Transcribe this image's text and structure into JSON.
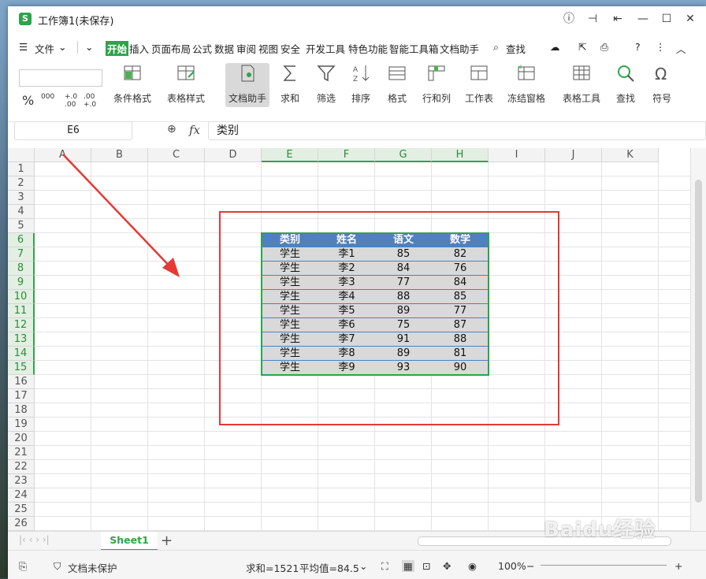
{
  "window": {
    "title": "工作簿1(未保存)",
    "app_icon": "S"
  },
  "menu": {
    "file": "文件",
    "tabs": [
      "开始",
      "插入",
      "页面布局",
      "公式",
      "数据",
      "审阅",
      "视图",
      "安全",
      "开发工具",
      "特色功能",
      "智能工具箱",
      "文档助手"
    ],
    "search": "查找"
  },
  "ribbon": {
    "buttons": [
      "条件格式",
      "表格样式",
      "文档助手",
      "求和",
      "筛选",
      "排序",
      "格式",
      "行和列",
      "工作表",
      "冻结窗格",
      "表格工具",
      "查找",
      "符号"
    ],
    "number_formats": [
      "%",
      "000",
      "+.0 .00",
      ".00 +.0"
    ]
  },
  "formula_bar": {
    "name_box": "E6",
    "fx": "fx",
    "content": "类别"
  },
  "columns": [
    "A",
    "B",
    "C",
    "D",
    "E",
    "F",
    "G",
    "H",
    "I",
    "J",
    "K"
  ],
  "rows": [
    "1",
    "2",
    "3",
    "4",
    "5",
    "6",
    "7",
    "8",
    "9",
    "10",
    "11",
    "12",
    "13",
    "14",
    "15",
    "16",
    "17",
    "18",
    "19",
    "20",
    "21",
    "22",
    "23",
    "24",
    "25",
    "26"
  ],
  "table": {
    "headers": [
      "类别",
      "姓名",
      "语文",
      "数学"
    ],
    "rows": [
      [
        "学生",
        "李1",
        "85",
        "82"
      ],
      [
        "学生",
        "李2",
        "84",
        "76"
      ],
      [
        "学生",
        "李3",
        "77",
        "84"
      ],
      [
        "学生",
        "李4",
        "88",
        "85"
      ],
      [
        "学生",
        "李5",
        "89",
        "77"
      ],
      [
        "学生",
        "李6",
        "75",
        "87"
      ],
      [
        "学生",
        "李7",
        "91",
        "88"
      ],
      [
        "学生",
        "李8",
        "89",
        "81"
      ],
      [
        "学生",
        "李9",
        "93",
        "90"
      ]
    ]
  },
  "sheets": [
    "Sheet1"
  ],
  "status": {
    "protect": "文档未保护",
    "sum": "求和=1521",
    "avg": "平均值=84.5",
    "zoom": "100%"
  },
  "watermark": "Baidu经验",
  "colors": {
    "accent": "#2fa34a",
    "table_header": "#4f81bd",
    "table_body": "#d9d9d9",
    "annotation": "#e53935"
  }
}
